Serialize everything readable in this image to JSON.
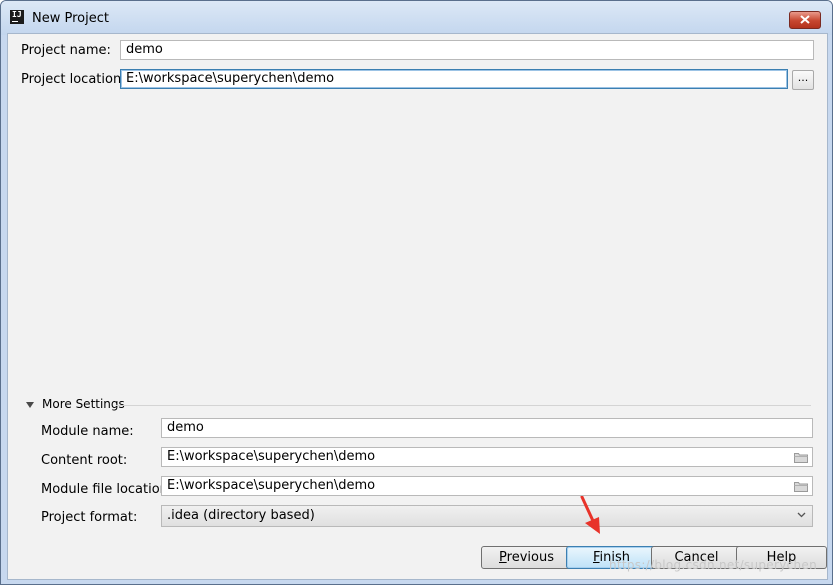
{
  "window": {
    "title": "New Project",
    "app_icon": "IJ"
  },
  "project": {
    "name_label": "Project name:",
    "name_value": "demo",
    "location_label": "Project location:",
    "location_value": "E:\\workspace\\superychen\\demo",
    "browse_label": "..."
  },
  "more_settings": {
    "header": "More Settings",
    "module_name_label": "Module name:",
    "module_name_value": "demo",
    "content_root_label": "Content root:",
    "content_root_value": "E:\\workspace\\superychen\\demo",
    "module_file_label": "Module file location:",
    "module_file_value": "E:\\workspace\\superychen\\demo",
    "format_label": "Project format:",
    "format_value": ".idea (directory based)"
  },
  "buttons": {
    "previous": {
      "mnemonic": "P",
      "rest": "revious"
    },
    "finish": {
      "mnemonic": "F",
      "rest": "inish"
    },
    "cancel": "Cancel",
    "help": "Help"
  },
  "watermark": "https://blog.csdn.net/superychen",
  "colors": {
    "accent_arrow": "#e8332a",
    "focus_border": "#3c7fb1"
  }
}
